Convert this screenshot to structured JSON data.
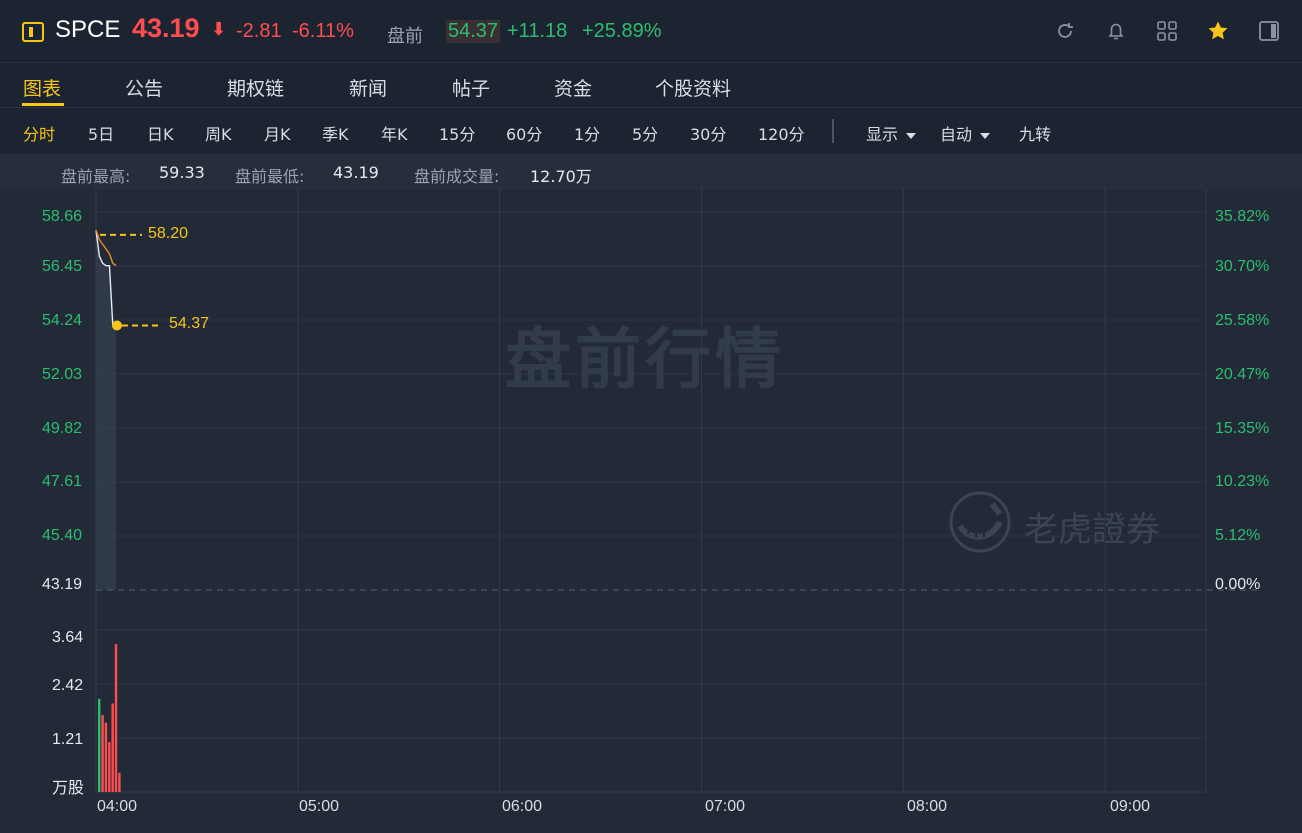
{
  "header": {
    "symbol": "SPCE",
    "price": "43.19",
    "price_arrow": "⬇",
    "change": "-2.81",
    "change_pct": "-6.11%",
    "premarket_label": "盘前",
    "premarket_price": "54.37",
    "premarket_change": "+11.18",
    "premarket_change_pct": "+25.89%",
    "colors": {
      "down": "#ff4d4f",
      "up": "#2dbd6e",
      "accent": "#f5c518"
    }
  },
  "tabs": [
    {
      "label": "图表",
      "active": true
    },
    {
      "label": "公告"
    },
    {
      "label": "期权链"
    },
    {
      "label": "新闻"
    },
    {
      "label": "帖子"
    },
    {
      "label": "资金"
    },
    {
      "label": "个股资料"
    }
  ],
  "toolbar": {
    "periods": [
      "分时",
      "5日",
      "日K",
      "周K",
      "月K",
      "季K",
      "年K",
      "15分",
      "60分",
      "1分",
      "5分",
      "30分",
      "120分"
    ],
    "active_period": "分时",
    "display_label": "显示",
    "auto_label": "自动",
    "nine_turn_label": "九转"
  },
  "stats": {
    "high_label": "盘前最高:",
    "high_value": "59.33",
    "low_label": "盘前最低:",
    "low_value": "43.19",
    "volume_label": "盘前成交量:",
    "volume_value": "12.70万"
  },
  "chart": {
    "watermark": "盘前行情",
    "brand": "老虎證券",
    "price_axis_left": [
      "58.66",
      "56.45",
      "54.24",
      "52.03",
      "49.82",
      "47.61",
      "45.40",
      "43.19"
    ],
    "price_axis_right": [
      "35.82%",
      "30.70%",
      "25.58%",
      "20.47%",
      "15.35%",
      "10.23%",
      "5.12%",
      "0.00%"
    ],
    "volume_axis": [
      "3.64",
      "2.42",
      "1.21",
      "万股"
    ],
    "time_axis": [
      "04:00",
      "05:00",
      "06:00",
      "07:00",
      "08:00",
      "09:00"
    ],
    "callout_high": "58.20",
    "callout_last": "54.37"
  },
  "chart_data": {
    "type": "line",
    "x_unit": "time",
    "xlim": [
      "04:00",
      "09:30"
    ],
    "ylim": [
      43.19,
      59.33
    ],
    "base_price": 43.19,
    "series": [
      {
        "x": [
          "04:00",
          "04:01",
          "04:02",
          "04:03",
          "04:04",
          "04:05",
          "04:06"
        ],
        "values": [
          58.4,
          57.3,
          57.0,
          56.9,
          56.9,
          54.37,
          54.37
        ]
      },
      {
        "x": [
          "04:00",
          "04:01",
          "04:02",
          "04:03",
          "04:04",
          "04:05",
          "04:06"
        ],
        "values": [
          58.4,
          58.0,
          57.8,
          57.6,
          57.4,
          57.0,
          56.9
        ]
      }
    ],
    "volume": {
      "unit": "万股",
      "ylim": [
        0,
        4.0
      ],
      "x": [
        "04:00",
        "04:01",
        "04:02",
        "04:03",
        "04:04",
        "04:05",
        "04:06"
      ],
      "values": [
        2.42,
        2.0,
        1.8,
        1.3,
        2.3,
        3.84,
        0.5
      ],
      "colors": [
        "#2dbd6e",
        "#ff4d4f",
        "#ff4d4f",
        "#ff4d4f",
        "#ff4d4f",
        "#ff4d4f",
        "#ff4d4f"
      ]
    },
    "annotations": [
      {
        "label": "58.20",
        "value": 58.2
      },
      {
        "label": "54.37",
        "value": 54.37
      }
    ]
  }
}
